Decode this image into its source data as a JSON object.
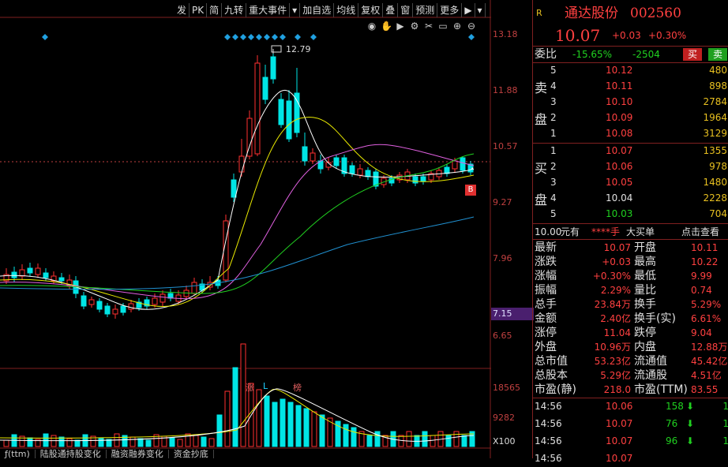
{
  "toolbar": {
    "items": [
      "发",
      "PK",
      "简",
      "九转",
      "重大事件",
      "▾",
      "加自选",
      "均线",
      "复权",
      "叠",
      "窗",
      "预测",
      "更多",
      "▶",
      "▾"
    ]
  },
  "price_axis": [
    "13.18",
    "11.88",
    "10.57",
    "9.27",
    "7.96",
    "6.65"
  ],
  "current_price_tag": "7.15",
  "max_label": "12.79",
  "zlb_marks": [
    "涨",
    "L",
    "榜"
  ],
  "volume_axis": [
    "18565",
    "9282",
    "X100"
  ],
  "bottom_tabs": [
    "ƒ(ttm)",
    "陆股通持股变化",
    "融资融券变化",
    "资金抄底"
  ],
  "icons": [
    "eye-icon",
    "hand-icon",
    "play-icon",
    "settings-icon",
    "scissors-icon",
    "window-icon",
    "zoom-in-icon",
    "zoom-out-icon"
  ],
  "colors": {
    "up": "#ff3030",
    "down": "#00e5e5",
    "ma5": "#ffffff",
    "ma10": "#e8e800",
    "ma20": "#e060e0",
    "ma30": "#20d020",
    "ma60": "#2090d0",
    "accent": "#802020"
  },
  "quote": {
    "r_badge": "R",
    "name": "通达股份",
    "code": "002560",
    "price": "10.07",
    "change": "+0.03",
    "change_pct": "+0.30%",
    "weibi_label": "委比",
    "weibi_pct": "-15.65%",
    "weicha": "-2504",
    "buy_btn": "买",
    "sell_btn": "卖",
    "sell_side_label": [
      "卖",
      "盘"
    ],
    "buy_side_label": [
      "买",
      "盘"
    ],
    "asks": [
      {
        "level": "5",
        "price": "10.12",
        "vol": "480"
      },
      {
        "level": "4",
        "price": "10.11",
        "vol": "898"
      },
      {
        "level": "3",
        "price": "10.10",
        "vol": "2784"
      },
      {
        "level": "2",
        "price": "10.09",
        "vol": "1964"
      },
      {
        "level": "1",
        "price": "10.08",
        "vol": "3129"
      }
    ],
    "bids": [
      {
        "level": "1",
        "price": "10.07",
        "vol": "1355"
      },
      {
        "level": "2",
        "price": "10.06",
        "vol": "978"
      },
      {
        "level": "3",
        "price": "10.05",
        "vol": "1480"
      },
      {
        "level": "4",
        "price": "10.04",
        "vol": "2228"
      },
      {
        "level": "5",
        "price": "10.03",
        "vol": "704"
      }
    ],
    "bigorder": {
      "price": "10.00",
      "text": "元有",
      "stars": "****手",
      "big": "大买单",
      "link": "点击查看"
    },
    "stats": [
      {
        "l1": "最新",
        "v1": "10.07",
        "l2": "开盘",
        "v2": "10.11"
      },
      {
        "l1": "涨跌",
        "v1": "+0.03",
        "l2": "最高",
        "v2": "10.22"
      },
      {
        "l1": "涨幅",
        "v1": "+0.30%",
        "l2": "最低",
        "v2": "9.99"
      },
      {
        "l1": "振幅",
        "v1": "2.29%",
        "l2": "量比",
        "v2": "0.74"
      },
      {
        "l1": "总手",
        "v1": "23.84万",
        "l2": "换手",
        "v2": "5.29%"
      },
      {
        "l1": "金额",
        "v1": "2.40亿",
        "l2": "换手(实)",
        "v2": "6.61%"
      },
      {
        "l1": "涨停",
        "v1": "11.04",
        "l2": "跌停",
        "v2": "9.04"
      },
      {
        "l1": "外盘",
        "v1": "10.96万",
        "l2": "内盘",
        "v2": "12.88万"
      },
      {
        "l1": "总市值",
        "v1": "53.23亿",
        "l2": "流通值",
        "v2": "45.42亿"
      },
      {
        "l1": "总股本",
        "v1": "5.29亿",
        "l2": "流通股",
        "v2": "4.51亿"
      },
      {
        "l1": "市盈(静)",
        "v1": "218.0",
        "l2": "市盈(TTM)",
        "v2": "83.55"
      }
    ],
    "ticks": [
      {
        "time": "14:56",
        "price": "10.06",
        "vol": "158",
        "extra": "1"
      },
      {
        "time": "14:56",
        "price": "10.07",
        "vol": "76",
        "extra": "1"
      },
      {
        "time": "14:56",
        "price": "10.07",
        "vol": "96",
        "extra": "1"
      },
      {
        "time": "14:56",
        "price": "10.07",
        "vol": "",
        "extra": ""
      }
    ]
  }
}
